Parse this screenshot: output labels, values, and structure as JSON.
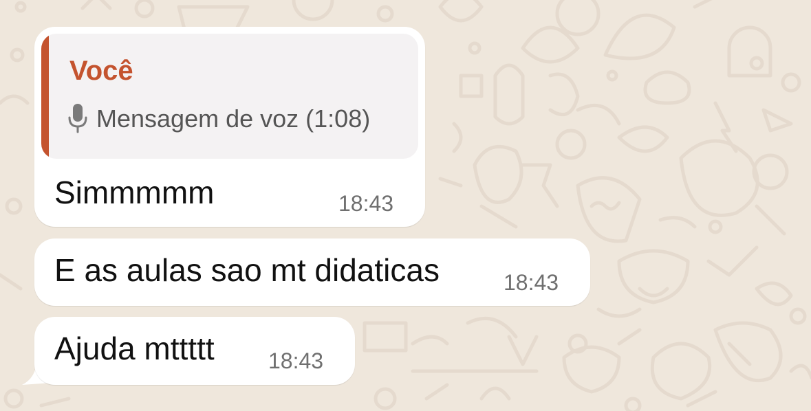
{
  "colors": {
    "wallpaper": "#efe7dc",
    "doodle": "#e5dace",
    "bubble": "#ffffff",
    "quote_background": "#f4f2f3",
    "quote_accent": "#c4532e",
    "quote_text": "#555555",
    "message_text": "#111111",
    "timestamp": "#6f6f6f"
  },
  "quoted_message": {
    "author": "Você",
    "icon": "microphone-icon",
    "text": "Mensagem de voz (1:08)"
  },
  "messages": [
    {
      "text": "Simmmmm",
      "time": "18:43",
      "has_quote": true
    },
    {
      "text": "E as aulas sao mt didaticas",
      "time": "18:43"
    },
    {
      "text": "Ajuda mttttt",
      "time": "18:43",
      "has_tail": true
    }
  ]
}
